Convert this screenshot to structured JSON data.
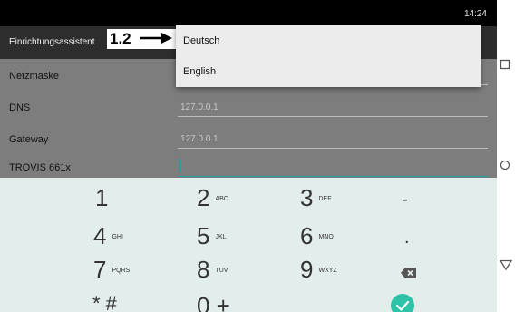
{
  "status": {
    "time": "14:24"
  },
  "actionbar": {
    "title": "Einrichtungsassistent"
  },
  "annotation": {
    "label": "1.2"
  },
  "dropdown": {
    "options": [
      "Deutsch",
      "English"
    ]
  },
  "form": {
    "rows": [
      {
        "label": "Netzmaske",
        "value": ""
      },
      {
        "label": "DNS",
        "value": "127.0.0.1"
      },
      {
        "label": "Gateway",
        "value": "127.0.0.1"
      },
      {
        "label": "TROVIS 661x",
        "value": ""
      }
    ]
  },
  "keypad": {
    "keys": [
      {
        "main": "1",
        "sub": ""
      },
      {
        "main": "2",
        "sub": "ABC"
      },
      {
        "main": "3",
        "sub": "DEF"
      },
      {
        "main": "-",
        "sub": ""
      },
      {
        "main": "4",
        "sub": "GHI"
      },
      {
        "main": "5",
        "sub": "JKL"
      },
      {
        "main": "6",
        "sub": "MNO"
      },
      {
        "main": ".",
        "sub": ""
      },
      {
        "main": "7",
        "sub": "PQRS"
      },
      {
        "main": "8",
        "sub": "TUV"
      },
      {
        "main": "9",
        "sub": "WXYZ"
      },
      {
        "main": "* #",
        "sub": ""
      },
      {
        "main": "0 +",
        "sub": ""
      }
    ]
  },
  "icons": {
    "backspace": "backspace-icon",
    "done": "check-icon",
    "recent": "recent-apps-icon",
    "home": "home-icon",
    "back": "back-icon"
  },
  "colors": {
    "accent": "#1aa2a0",
    "done": "#2ec3a8"
  }
}
